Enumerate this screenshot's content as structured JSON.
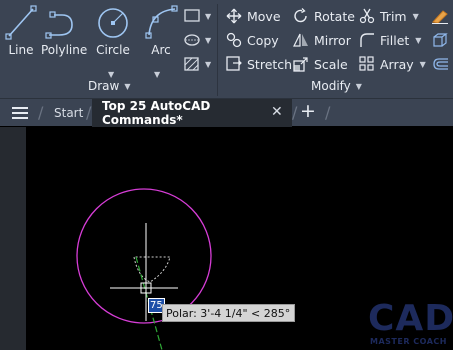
{
  "ribbon": {
    "draw": {
      "tools": [
        {
          "label": "Line",
          "icon": "line-icon"
        },
        {
          "label": "Polyline",
          "icon": "polyline-icon"
        },
        {
          "label": "Circle",
          "icon": "circle-icon"
        },
        {
          "label": "Arc",
          "icon": "arc-icon"
        }
      ],
      "small_tools": [
        "rectangle-icon",
        "hatch-icon",
        "ellipse-icon"
      ],
      "title": "Draw"
    },
    "modify": {
      "items": [
        {
          "label": "Move",
          "icon": "move-icon"
        },
        {
          "label": "Rotate",
          "icon": "rotate-icon"
        },
        {
          "label": "Trim",
          "icon": "trim-icon"
        },
        {
          "label": "Copy",
          "icon": "copy-icon"
        },
        {
          "label": "Mirror",
          "icon": "mirror-icon"
        },
        {
          "label": "Fillet",
          "icon": "fillet-icon"
        },
        {
          "label": "Stretch",
          "icon": "stretch-icon"
        },
        {
          "label": "Scale",
          "icon": "scale-icon"
        },
        {
          "label": "Array",
          "icon": "array-icon"
        }
      ],
      "title": "Modify"
    }
  },
  "tabs": {
    "start": "Start",
    "active": "Top 25 AutoCAD Commands*"
  },
  "canvas": {
    "dynamic_input": "75",
    "polar_tooltip": "Polar: 3'-4 1/4\" < 285°"
  },
  "logo": {
    "main": "CAD",
    "sub": "MASTER COACH"
  },
  "colors": {
    "ribbon": "#3b4453",
    "circle": "#d63dd6",
    "crosshair": "#ffffff",
    "polar_tracking": "#2fa836"
  }
}
